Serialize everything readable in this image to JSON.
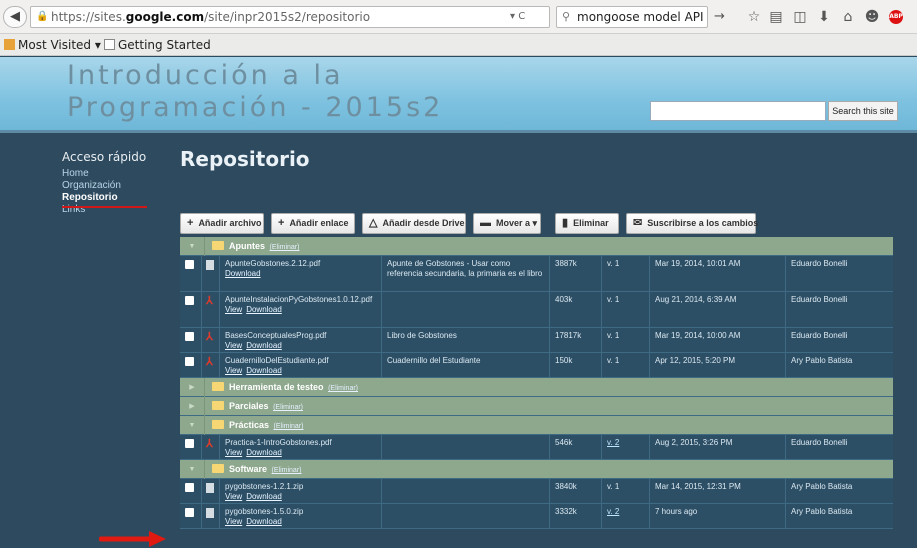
{
  "browser": {
    "url_prefix": "https://sites.",
    "url_domain": "google.com",
    "url_path": "/site/inpr2015s2/repositorio",
    "search_value": "mongoose model API",
    "bookmarks": [
      {
        "label": "Most Visited ▾",
        "icon": "folder-icon"
      },
      {
        "label": "Getting Started",
        "icon": "page-icon"
      }
    ]
  },
  "site": {
    "title_line1": "Introducción a la",
    "title_line2": "Programación - 2015s2",
    "search_button": "Search this site"
  },
  "sidebar": {
    "title": "Acceso rápido",
    "items": [
      {
        "label": "Home",
        "active": false
      },
      {
        "label": "Organización",
        "active": false
      },
      {
        "label": "Repositorio",
        "active": true
      },
      {
        "label": "Links",
        "active": false
      }
    ]
  },
  "main": {
    "title": "Repositorio",
    "toolbar": [
      {
        "label": "Añadir archivo",
        "icon": "plus-icon"
      },
      {
        "label": "Añadir enlace",
        "icon": "plus-icon"
      },
      {
        "label": "Añadir desde Drive",
        "icon": "drive-icon"
      },
      {
        "label": "Mover a",
        "icon": "folder-icon",
        "dropdown": "▾"
      },
      {
        "label": "Eliminar",
        "icon": "trash-icon"
      },
      {
        "label": "Suscribirse a los cambios",
        "icon": "mail-icon"
      }
    ],
    "folders": {
      "apuntes": {
        "name": "Apuntes",
        "delete": "(Eliminar)"
      },
      "herramienta": {
        "name": "Herramienta de testeo",
        "delete": "(Eliminar)"
      },
      "parciales": {
        "name": "Parciales",
        "delete": "(Eliminar)"
      },
      "practicas": {
        "name": "Prácticas",
        "delete": "(Eliminar)"
      },
      "software": {
        "name": "Software",
        "delete": "(Eliminar)"
      }
    },
    "files": {
      "f1": {
        "name": "ApunteGobstones.2.12.pdf",
        "links": [
          "Download"
        ],
        "desc": "Apunte de Gobstones - Usar como referencia secundaria, la primaria es el libro",
        "size": "3887k",
        "ver": "v. 1",
        "date": "Mar 19, 2014, 10:01 AM",
        "user": "Eduardo Bonelli"
      },
      "f2": {
        "name": "ApunteInstalacionPyGobstones1.0.12.pdf",
        "links": [
          "View",
          "Download"
        ],
        "desc": "",
        "size": "403k",
        "ver": "v. 1",
        "date": "Aug 21, 2014, 6:39 AM",
        "user": "Eduardo Bonelli"
      },
      "f3": {
        "name": "BasesConceptualesProg.pdf",
        "links": [
          "View",
          "Download"
        ],
        "desc": "Libro de Gobstones",
        "size": "17817k",
        "ver": "v. 1",
        "date": "Mar 19, 2014, 10:00 AM",
        "user": "Eduardo Bonelli"
      },
      "f4": {
        "name": "CuadernilloDelEstudiante.pdf",
        "links": [
          "View",
          "Download"
        ],
        "desc": "Cuadernillo del Estudiante",
        "size": "150k",
        "ver": "v. 1",
        "date": "Apr 12, 2015, 5:20 PM",
        "user": "Ary Pablo Batista"
      },
      "f5": {
        "name": "Practica-1-IntroGobstones.pdf",
        "links": [
          "View",
          "Download"
        ],
        "desc": "",
        "size": "546k",
        "ver": "v. 2",
        "date": "Aug 2, 2015, 3:26 PM",
        "user": "Eduardo Bonelli"
      },
      "f6": {
        "name": "pygobstones-1.2.1.zip",
        "links": [
          "View",
          "Download"
        ],
        "desc": "",
        "size": "3840k",
        "ver": "v. 1",
        "date": "Mar 14, 2015, 12:31 PM",
        "user": "Ary Pablo Batista"
      },
      "f7": {
        "name": "pygobstones-1.5.0.zip",
        "links": [
          "View",
          "Download"
        ],
        "desc": "",
        "size": "3332k",
        "ver": "v. 2",
        "date": "7 hours ago",
        "user": "Ary Pablo Batista"
      }
    }
  },
  "colors": {
    "accent_red": "#d01818",
    "folder_row": "#8ea88d",
    "page_bg": "#2e4a5e"
  }
}
